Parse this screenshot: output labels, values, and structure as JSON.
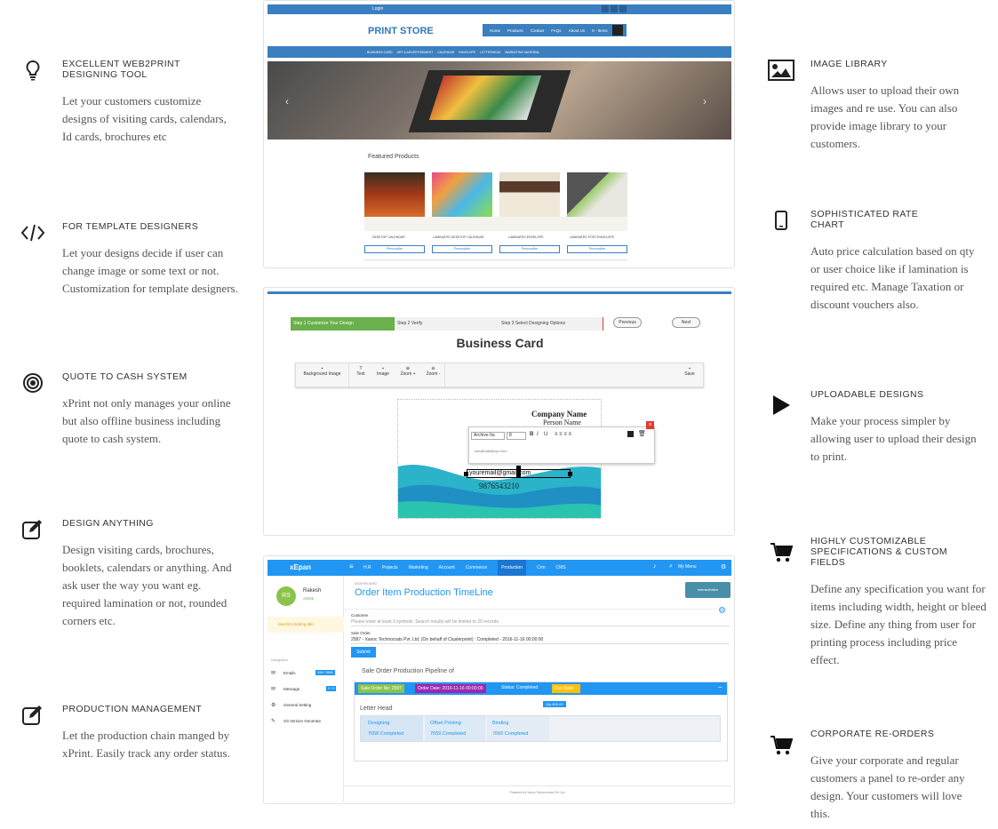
{
  "features_left": [
    {
      "title": "EXCELLENT WEB2PRINT DESIGNING TOOL",
      "text": "Let your customers customize designs of visiting cards, calendars, Id cards, brochures etc",
      "icon": "lightbulb-icon"
    },
    {
      "title": "FOR TEMPLATE DESIGNERS",
      "text": "Let your designs decide if user can change image or some text or not. Customization for template designers.",
      "icon": "code-icon"
    },
    {
      "title": "QUOTE TO CASH SYSTEM",
      "text": "xPrint not only manages your online but also offline business including quote to cash system.",
      "icon": "target-icon"
    },
    {
      "title": "DESIGN ANYTHING",
      "text": "Design visiting cards, brochures, booklets, calendars or anything. And ask user the way you want eg. required lamination or not, rounded corners etc.",
      "icon": "edit-icon"
    },
    {
      "title": "PRODUCTION MANAGEMENT",
      "text": "Let the production chain manged by xPrint. Easily track any order status.",
      "icon": "edit-icon"
    }
  ],
  "features_right": [
    {
      "title": "IMAGE LIBRARY",
      "text": "Allows user to upload their own images and re use. You can also provide image library to your customers.",
      "icon": "image-icon"
    },
    {
      "title": "SOPHISTICATED RATE CHART",
      "text": "Auto price calculation based on qty or user choice like if lamination is required etc. Manage Taxation or discount vouchers also.",
      "icon": "mobile-icon"
    },
    {
      "title": "UPLOADABLE DESIGNS",
      "text": "Make your process simpler by allowing user to upload their design to print.",
      "icon": "play-icon"
    },
    {
      "title": "HIGHLY CUSTOMIZABLE SPECIFICATIONS & CUSTOM FIELDS",
      "text": "Define any specification you want for items including width, height or bleed size. Define any thing from user for printing process including price effect.",
      "icon": "cart-icon"
    },
    {
      "title": "CORPORATE RE-ORDERS",
      "text": "Give your corporate and regular customers a panel to re-order any design. Your customers will love this.",
      "icon": "cart-icon"
    }
  ],
  "store": {
    "topbar": "Login",
    "logo": "PRINT STORE",
    "nav": [
      "Home",
      "Products",
      "Contact",
      "FAQs",
      "About Us",
      "0 - Items"
    ],
    "subnav": [
      "BUSINESS CARD",
      "ART & ADVERTISEMENT",
      "CALENDAR",
      "ENVELOPE",
      "LETTERHEAD",
      "MARKETING MATERIAL"
    ],
    "featured_title": "Featured Products",
    "products": [
      {
        "name": "DESKTOP CALENDAR",
        "btn": "Personalize"
      },
      {
        "name": "LAMINATED DESKTOP CALENDAR",
        "btn": "Personalize"
      },
      {
        "name": "LAMINATED ENVELOPE",
        "btn": "Personalize"
      },
      {
        "name": "LAMINATED POST ENVELOPE",
        "btn": "Personalize"
      }
    ]
  },
  "editor": {
    "steps": [
      "Step 1 Customize Your Design",
      "Step 2 Verify",
      "Step 3 Select Designing Options"
    ],
    "prev": "Previous",
    "next": "Next",
    "title": "Business Card",
    "tools": [
      "Background Image",
      "Text",
      "Image",
      "Zoom +",
      "Zoom -"
    ],
    "save": "Save",
    "company": "Company Name",
    "person": "Person Name",
    "font": "Archive Ita",
    "size": "8",
    "email_small": "info@mail@xyz.com",
    "email": "youremail@gmail.com",
    "phone": "9876543210"
  },
  "admin": {
    "brand": "xEpan",
    "menus": [
      "H.R",
      "Projects",
      "Marketing",
      "Account",
      "Commerce",
      "Production",
      "Crm",
      "CMS"
    ],
    "user_menu": "My Menu",
    "avatar": "RS",
    "user": "Rakesh",
    "status": "Active",
    "warn": "See Em Setting Idle",
    "nav_header": "Navigation",
    "nav": [
      {
        "label": "Emails",
        "badge": "0/64 / 9848"
      },
      {
        "label": "Message",
        "badge": "0 / 0"
      },
      {
        "label": "General Setting",
        "badge": ""
      },
      {
        "label": "Git Version Generate",
        "badge": ""
      }
    ],
    "breadcrumb": "DASHBOARD",
    "page_title": "Order Item Production TimeLine",
    "action_btn": "Interactivities",
    "customer_label": "Customer",
    "customer_placeholder": "Please enter at least 3 symbols. Search results will be limited to 20 records.",
    "sale_order_label": "Sale Order",
    "sale_order_value": "2587 - Xavoc Technocrats Pvt. Ltd. (On behalf of Clusterpoint) : Completed - 2016-11-16 00:00:00",
    "submit": "Submit",
    "pipeline_title": "Sale Order Production Pipeline of",
    "badges": [
      "Sale Order No: 2587",
      "Order Date: 2016-11-16 00:00:00",
      "Status: Completed",
      "Due Date: -"
    ],
    "item": "Letter Head",
    "qty": "Qty 800.00",
    "stages": [
      {
        "name": "Designing",
        "status": "7658 Completed"
      },
      {
        "name": "Offset Printing",
        "status": "7659 Completed"
      },
      {
        "name": "Binding",
        "status": "7660 Completed"
      }
    ],
    "footer": "Powered by Xavoc Technocrats Pvt. Ltd."
  },
  "colors": {
    "blue": "#3a7fc0",
    "admin_blue": "#2196f3",
    "green": "#6ab04c",
    "teal": "#36b8c9",
    "text": "#333333"
  }
}
